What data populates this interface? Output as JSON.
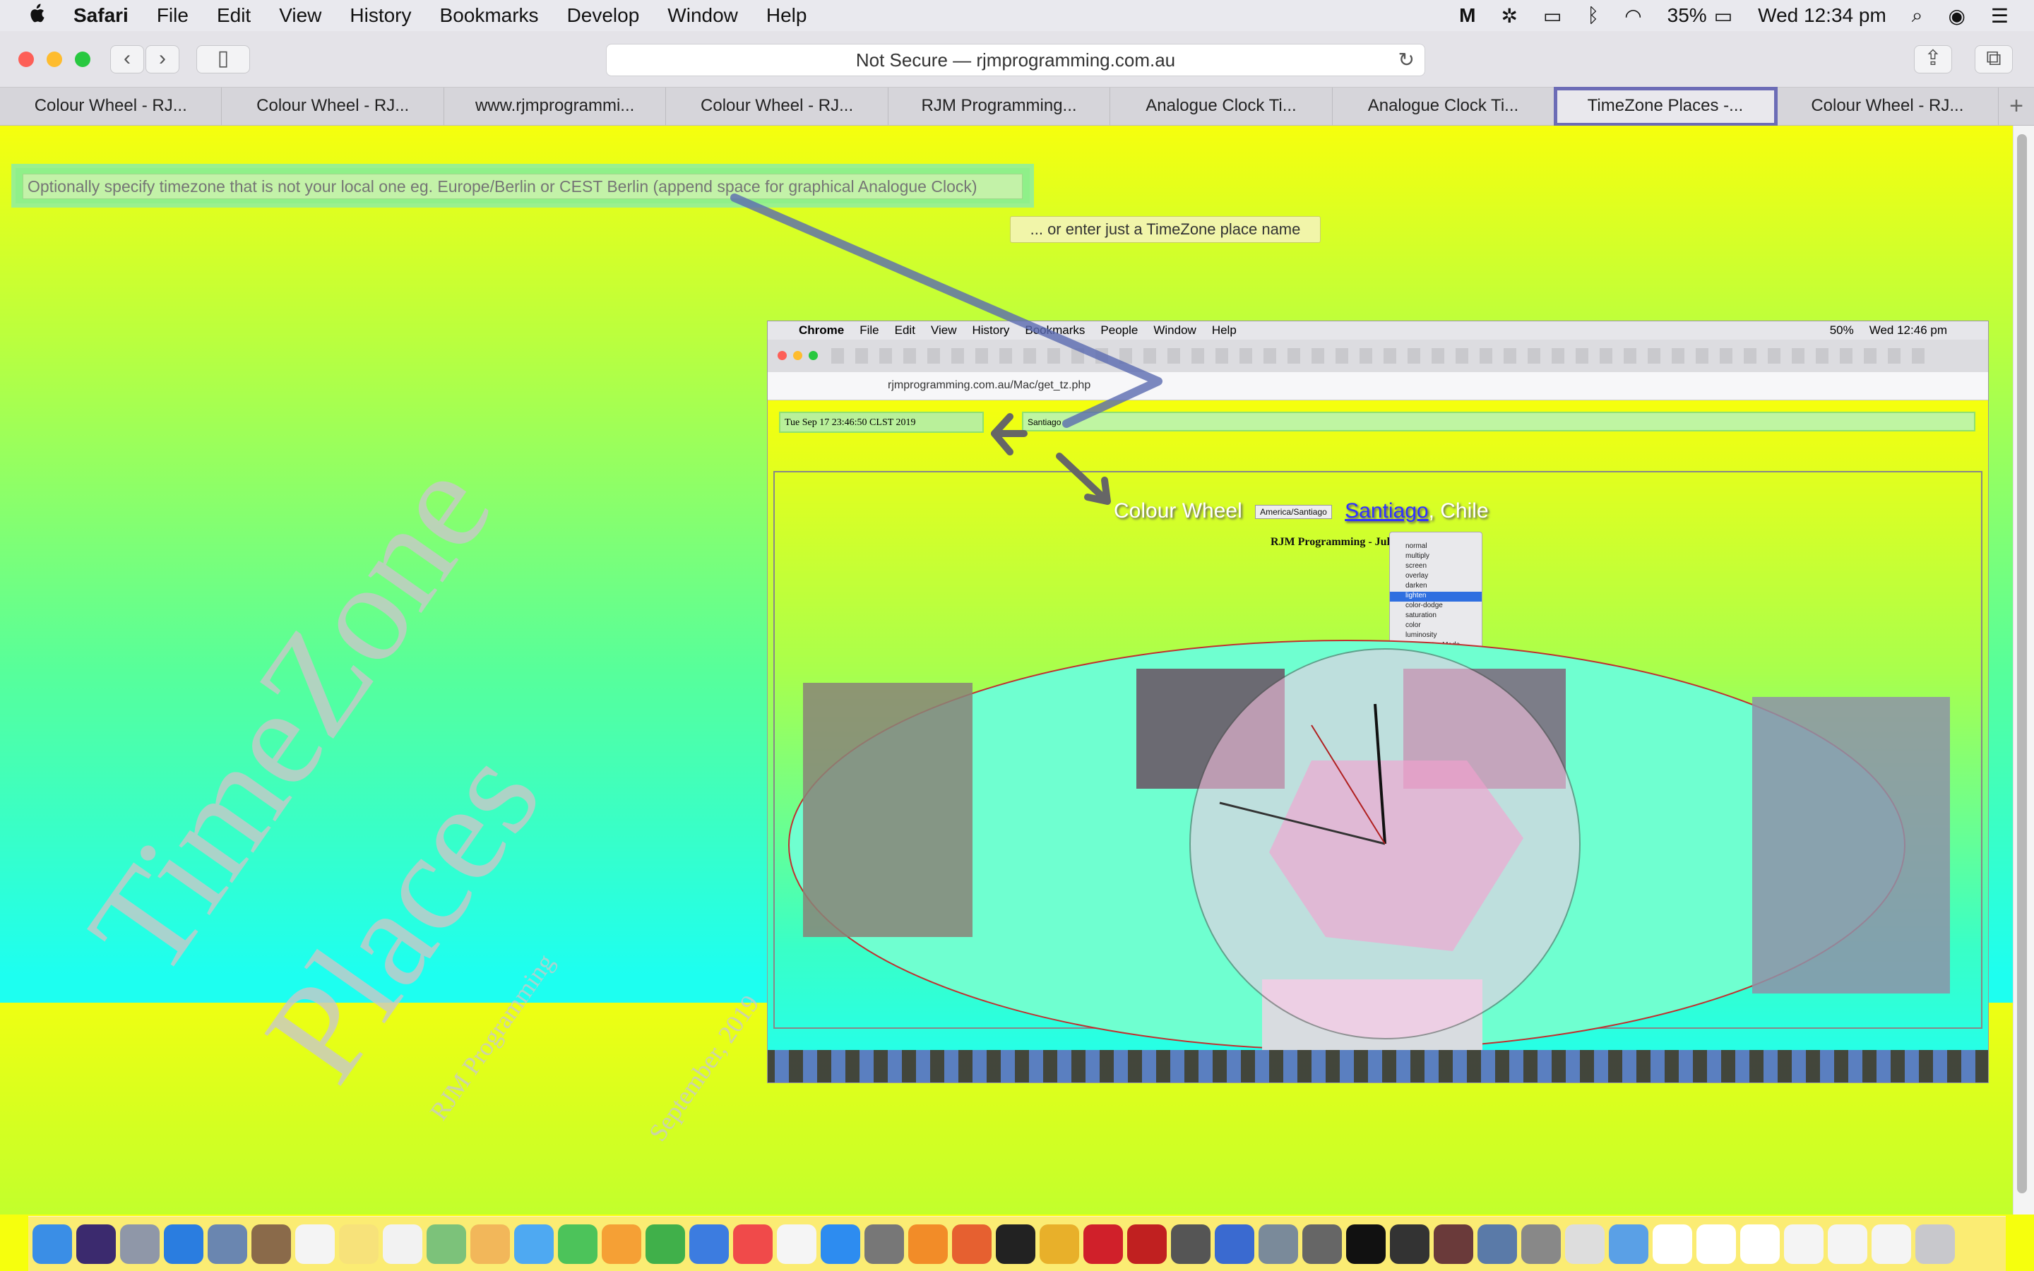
{
  "menubar": {
    "apple": "",
    "app": "Safari",
    "items": [
      "File",
      "Edit",
      "View",
      "History",
      "Bookmarks",
      "Develop",
      "Window",
      "Help"
    ],
    "battery": "35%",
    "clock": "Wed 12:34 pm"
  },
  "toolbar": {
    "url": "Not Secure — rjmprogramming.com.au",
    "back": "‹",
    "forward": "›",
    "sidebar": "▯",
    "reload": "↻",
    "share": "⇪",
    "tabs_overview": "⧉"
  },
  "tabs": [
    {
      "label": "Colour Wheel - RJ..."
    },
    {
      "label": "Colour Wheel - RJ..."
    },
    {
      "label": "www.rjmprogrammi..."
    },
    {
      "label": "Colour Wheel - RJ..."
    },
    {
      "label": "RJM Programming..."
    },
    {
      "label": "Analogue Clock Ti..."
    },
    {
      "label": "Analogue Clock Ti..."
    },
    {
      "label": "TimeZone Places -..."
    },
    {
      "label": "Colour Wheel - RJ..."
    }
  ],
  "newtab": "+",
  "page": {
    "tz_placeholder": "Optionally specify timezone that is not your local one eg. Europe/Berlin or CEST Berlin (append space for graphical Analogue Clock)",
    "place_button": "... or enter just a TimeZone place name",
    "big_title_1": "TimeZone",
    "big_title_2": "Places",
    "watermark_1": "RJM Programming",
    "watermark_2": "September, 2019"
  },
  "embedded": {
    "menubar": {
      "app": "Chrome",
      "items": [
        "File",
        "Edit",
        "View",
        "History",
        "Bookmarks",
        "People",
        "Window",
        "Help"
      ],
      "battery": "50%",
      "clock": "Wed 12:46 pm"
    },
    "url": "rjmprogramming.com.au/Mac/get_tz.php",
    "time_display": "Tue Sep 17 23:46:50 CLST 2019",
    "place_input": "Santiago",
    "heading_colour_wheel": "Colour Wheel",
    "tz_select": "America/Santiago",
    "heading_city": "Santiago",
    "heading_country": ", Chile",
    "subheading": "RJM Programming - Jul",
    "blend_options": [
      "normal",
      "multiply",
      "screen",
      "overlay",
      "darken",
      "lighten",
      "color-dodge",
      "saturation",
      "color",
      "luminosity",
      "Non Avatar Mode"
    ],
    "blend_selected": "lighten"
  },
  "colors": {
    "accent_tab": "#6c6cb6",
    "page_top": "#f6ff0d",
    "page_mid": "#57ff9a",
    "page_bottom": "#1dfff0",
    "arrow": "#5a6ab0"
  }
}
